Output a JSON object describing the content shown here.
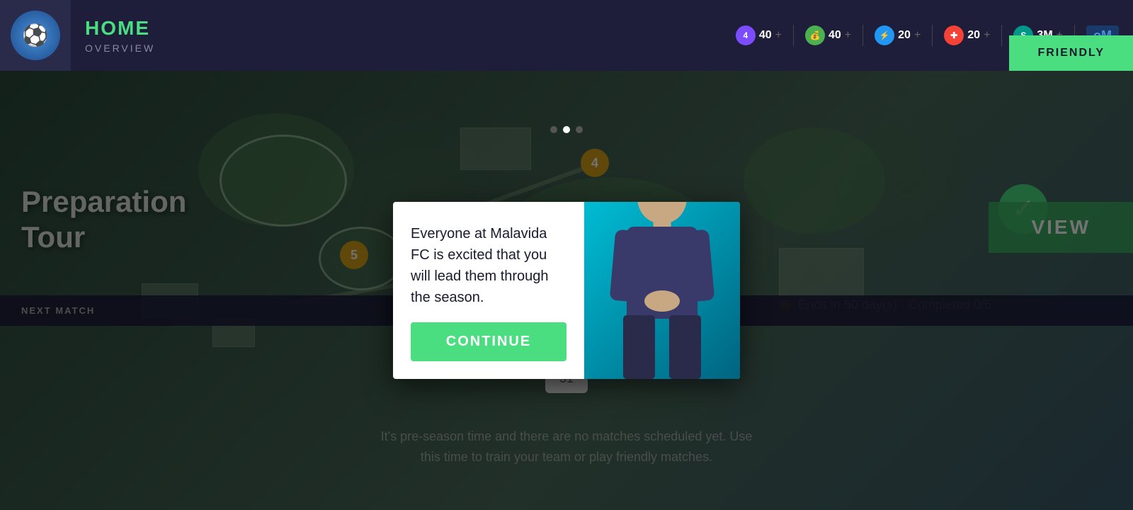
{
  "header": {
    "title": "HOME",
    "subtitle": "OVERVIEW",
    "friendly_button": "FRIENDLY",
    "om_badge": "oM"
  },
  "stats": [
    {
      "id": "stat1",
      "icon": "trophy",
      "icon_color": "purple",
      "icon_label": "4",
      "value": "40",
      "plus": "+"
    },
    {
      "id": "stat2",
      "icon": "coin",
      "icon_color": "green",
      "icon_label": "💰",
      "value": "40",
      "plus": "+"
    },
    {
      "id": "stat3",
      "icon": "lightning",
      "icon_color": "blue",
      "icon_label": "⚡",
      "value": "20",
      "plus": "+"
    },
    {
      "id": "stat4",
      "icon": "cross",
      "icon_color": "red",
      "icon_label": "✚",
      "value": "20",
      "plus": "+"
    },
    {
      "id": "stat5",
      "icon": "shield",
      "icon_color": "teal",
      "icon_label": "S",
      "value": "3M",
      "plus": "+"
    }
  ],
  "dots": [
    {
      "active": false
    },
    {
      "active": true
    },
    {
      "active": false
    }
  ],
  "map": {
    "prep_tour_line1": "Preparation",
    "prep_tour_line2": "Tour",
    "view_button": "VIEW",
    "ends_text": "Ends in 50 day(s) - Completed 0/5",
    "marker4": "4",
    "marker5": "5"
  },
  "next_match": {
    "label": "NEXT MATCH"
  },
  "no_match": {
    "line1": "It's pre-season time and there are no matches scheduled yet. Use",
    "line2": "this time to train your team or play friendly matches."
  },
  "modal": {
    "message": "Everyone at Malavida FC is excited that you will lead them through the season.",
    "continue_button": "CONTINUE"
  }
}
